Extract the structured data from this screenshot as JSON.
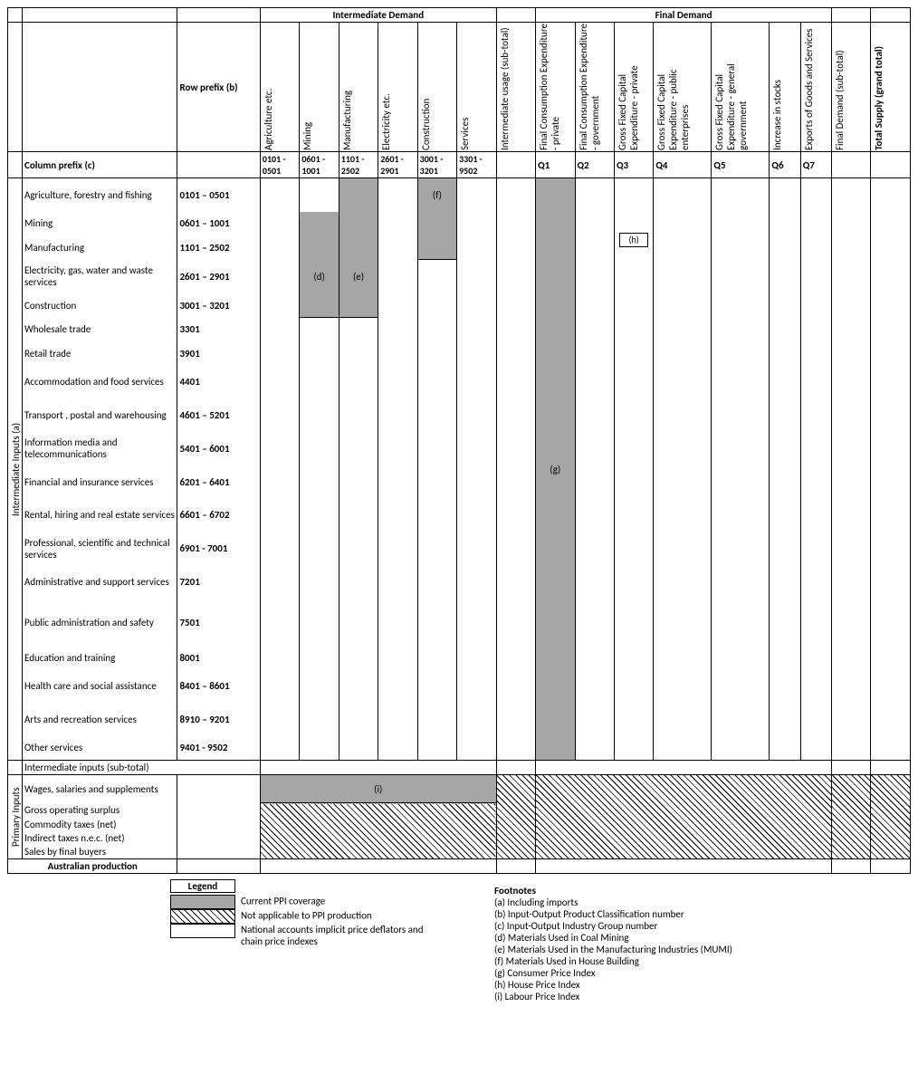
{
  "headers": {
    "intermediate_demand": "Intermediate Demand",
    "final_demand": "Final Demand",
    "row_prefix_b": "Row prefix (b)",
    "column_prefix_c": "Column prefix (c)",
    "cols": {
      "agriculture": "Agriculture etc.",
      "mining": "Mining",
      "manufacturing": "Manufacturing",
      "electricity": "Electricity etc.",
      "construction": "Construction",
      "services": "Services",
      "intermediate_usage": "Intermediate usage (sub-total)",
      "q1": "Final Consumption Expenditure - private",
      "q2": "Final Consumption Expenditure - government",
      "q3": "Gross Fixed Capital Expenditure - private",
      "q4": "Gross Fixed Capital Expenditure - public enterprises",
      "q5": "Gross Fixed Capital Expenditure - general government",
      "q6": "Increase in stocks",
      "q7": "Exports of Goods and Services",
      "fd_subtotal": "Final Demand (sub-total)",
      "total_supply": "Total Supply (grand total)"
    },
    "col_codes": {
      "c1": "0101 - 0501",
      "c2": "0601 - 1001",
      "c3": "1101 - 2502",
      "c4": "2601 - 2901",
      "c5": "3001 - 3201",
      "c6": "3301 - 9502",
      "q1": "Q1",
      "q2": "Q2",
      "q3": "Q3",
      "q4": "Q4",
      "q5": "Q5",
      "q6": "Q6",
      "q7": "Q7"
    }
  },
  "side_labels": {
    "intermediate_inputs_a": "Intermediate Inputs (a)",
    "primary_inputs": "Primary Inputs"
  },
  "rows": {
    "r1": {
      "label": "Agriculture, forestry and fishing",
      "code": "0101 – 0501"
    },
    "r2": {
      "label": "Mining",
      "code": "0601 – 1001"
    },
    "r3": {
      "label": "Manufacturing",
      "code": "1101 – 2502"
    },
    "r4": {
      "label": "Electricity, gas, water and waste services",
      "code": "2601 – 2901"
    },
    "r5": {
      "label": "Construction",
      "code": "3001 – 3201"
    },
    "r6": {
      "label": "Wholesale trade",
      "code": "3301"
    },
    "r7": {
      "label": "Retail trade",
      "code": "3901"
    },
    "r8": {
      "label": "Accommodation and food services",
      "code": "4401"
    },
    "r9": {
      "label": "Transport , postal and warehousing",
      "code": "4601 – 5201"
    },
    "r10": {
      "label": "Information media and telecommunications",
      "code": "5401 – 6001"
    },
    "r11": {
      "label": "Financial and insurance services",
      "code": "6201 – 6401"
    },
    "r12": {
      "label": "Rental, hiring and real estate services",
      "code": "6601 – 6702"
    },
    "r13": {
      "label": "Professional, scientific and technical services",
      "code": "6901 - 7001"
    },
    "r14": {
      "label": "Administrative and support services",
      "code": "7201"
    },
    "r15": {
      "label": "Public administration and safety",
      "code": "7501"
    },
    "r16": {
      "label": "Education and training",
      "code": "8001"
    },
    "r17": {
      "label": "Health care and social assistance",
      "code": "8401 – 8601"
    },
    "r18": {
      "label": "Arts and recreation services",
      "code": "8910 – 9201"
    },
    "r19": {
      "label": "Other services",
      "code": "9401 - 9502"
    }
  },
  "subtotal_row": "Intermediate inputs (sub-total)",
  "primary_rows": {
    "p1": "Wages, salaries and supplements",
    "p2": "Gross operating surplus",
    "p3": "Commodity taxes (net)",
    "p4": "Indirect taxes n.e.c. (net)",
    "p5": "Sales by final buyers"
  },
  "aus_production": "Australian production",
  "annotations": {
    "d": "(d)",
    "e": "(e)",
    "f": "(f)",
    "g": "(g)",
    "h": "(h)",
    "i": "(i)"
  },
  "legend": {
    "title": "Legend",
    "current": "Current PPI coverage",
    "na": "Not applicable to PPI production",
    "national": "National accounts implicit price deflators and chain price indexes"
  },
  "footnotes": {
    "title": "Footnotes",
    "a": "(a) Including imports",
    "b": "(b) Input-Output Product Classification number",
    "c": "(c) Input-Output Industry Group number",
    "d": "(d) Materials Used in Coal Mining",
    "e": "(e) Materials Used in the Manufacturing Industries (MUMI)",
    "f": "(f) Materials Used in House Building",
    "g": "(g) Consumer Price Index",
    "h": "(h) House Price Index",
    "i": "(i) Labour Price Index"
  }
}
